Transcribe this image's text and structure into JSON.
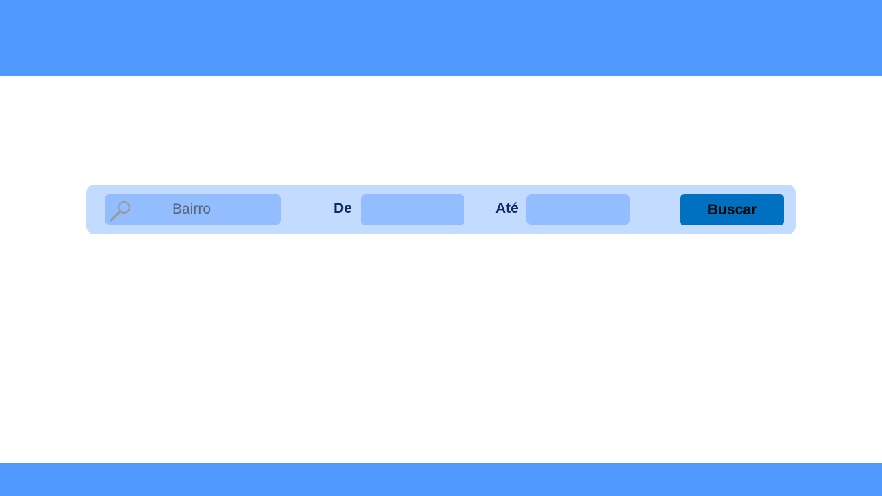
{
  "colors": {
    "header_band": "#4f99ff",
    "footer_band": "#4f99ff",
    "search_panel": "#c2dbfe",
    "field_background": "#92bdff",
    "label_text": "#0c2a66",
    "button_background": "#0070c0",
    "icon_stroke": "#9a9a9a"
  },
  "search": {
    "bairro": {
      "placeholder": "Bairro",
      "value": "",
      "icon": "search-icon"
    },
    "from_label": "De",
    "from_value": "",
    "to_label": "Até",
    "to_value": "",
    "button_label": "Buscar"
  }
}
